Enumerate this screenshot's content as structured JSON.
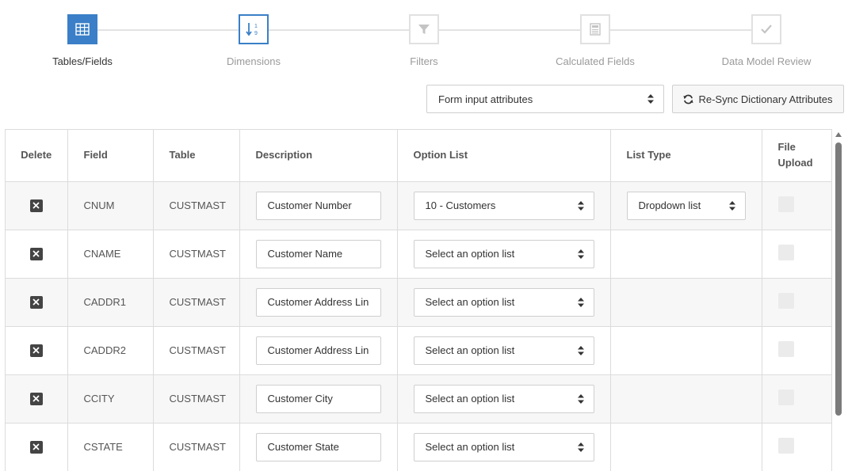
{
  "stepper": {
    "steps": [
      {
        "label": "Tables/Fields",
        "state": "done",
        "icon": "grid-icon"
      },
      {
        "label": "Dimensions",
        "state": "current",
        "icon": "sort-numeric-icon"
      },
      {
        "label": "Filters",
        "state": "upcoming",
        "icon": "filter-icon"
      },
      {
        "label": "Calculated Fields",
        "state": "upcoming",
        "icon": "calculator-icon"
      },
      {
        "label": "Data Model Review",
        "state": "upcoming",
        "icon": "checkmark-icon"
      }
    ],
    "sort_icon_digits": [
      "1",
      "9"
    ]
  },
  "toolbar": {
    "attributes_select": "Form input attributes",
    "resync_label": "Re-Sync Dictionary Attributes"
  },
  "table": {
    "headers": {
      "delete": "Delete",
      "field": "Field",
      "table": "Table",
      "description": "Description",
      "option_list": "Option List",
      "list_type": "List Type",
      "file_upload_1": "File",
      "file_upload_2": "Upload"
    },
    "rows": [
      {
        "field": "CNUM",
        "table": "CUSTMAST",
        "description": "Customer Number",
        "option_list": "10 - Customers",
        "list_type": "Dropdown list"
      },
      {
        "field": "CNAME",
        "table": "CUSTMAST",
        "description": "Customer Name",
        "option_list": "Select an option list",
        "list_type": ""
      },
      {
        "field": "CADDR1",
        "table": "CUSTMAST",
        "description": "Customer Address Lin",
        "option_list": "Select an option list",
        "list_type": ""
      },
      {
        "field": "CADDR2",
        "table": "CUSTMAST",
        "description": "Customer Address Lin",
        "option_list": "Select an option list",
        "list_type": ""
      },
      {
        "field": "CCITY",
        "table": "CUSTMAST",
        "description": "Customer City",
        "option_list": "Select an option list",
        "list_type": ""
      },
      {
        "field": "CSTATE",
        "table": "CUSTMAST",
        "description": "Customer State",
        "option_list": "Select an option list",
        "list_type": ""
      }
    ]
  },
  "colors": {
    "accent": "#3a7fc7",
    "row_alt": "#f7f7f7",
    "border": "#dcdcdc"
  }
}
